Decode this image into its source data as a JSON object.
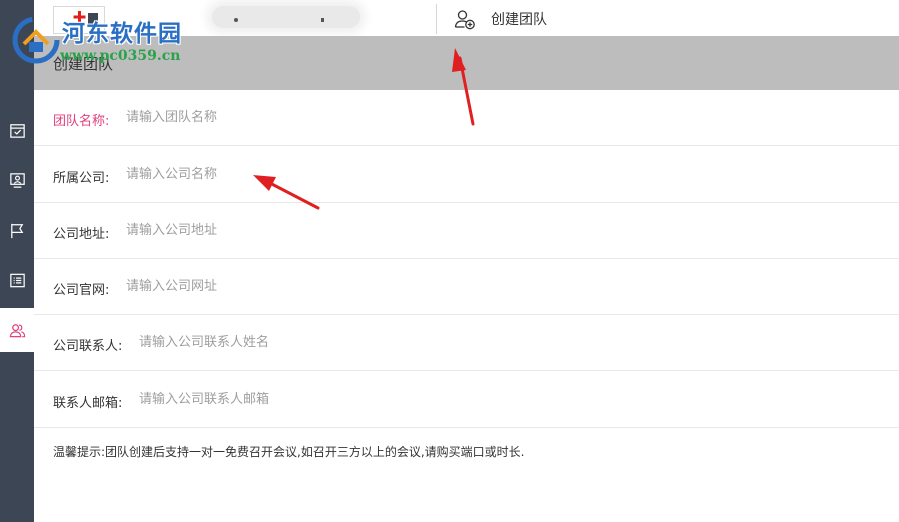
{
  "topbar": {
    "create_team_label": "创建团队"
  },
  "header": {
    "title": "创建团队"
  },
  "form": {
    "rows": [
      {
        "label": "团队名称:",
        "placeholder": "请输入团队名称",
        "value": ""
      },
      {
        "label": "所属公司:",
        "placeholder": "请输入公司名称",
        "value": ""
      },
      {
        "label": "公司地址:",
        "placeholder": "请输入公司地址",
        "value": ""
      },
      {
        "label": "公司官网:",
        "placeholder": "请输入公司网址",
        "value": ""
      },
      {
        "label": "公司联系人:",
        "placeholder": "请输入公司联系人姓名",
        "value": ""
      },
      {
        "label": "联系人邮箱:",
        "placeholder": "请输入公司联系人邮箱",
        "value": ""
      }
    ],
    "tip": "温馨提示:团队创建后支持一对一免费召开会议,如召开三方以上的会议,请购买端口或时长."
  },
  "sidebar": {
    "items": [
      {
        "icon": "calendar-check-icon"
      },
      {
        "icon": "monitor-user-icon"
      },
      {
        "icon": "flag-icon"
      },
      {
        "icon": "list-icon"
      },
      {
        "icon": "users-icon",
        "active": true
      }
    ]
  },
  "watermark": {
    "text": "河东软件园",
    "url": "www.pc0359.cn"
  },
  "colors": {
    "sidebar_bg": "#3c4654",
    "header_band": "#bdbdbd",
    "required_label": "#e0407d",
    "arrow": "#e02020"
  }
}
